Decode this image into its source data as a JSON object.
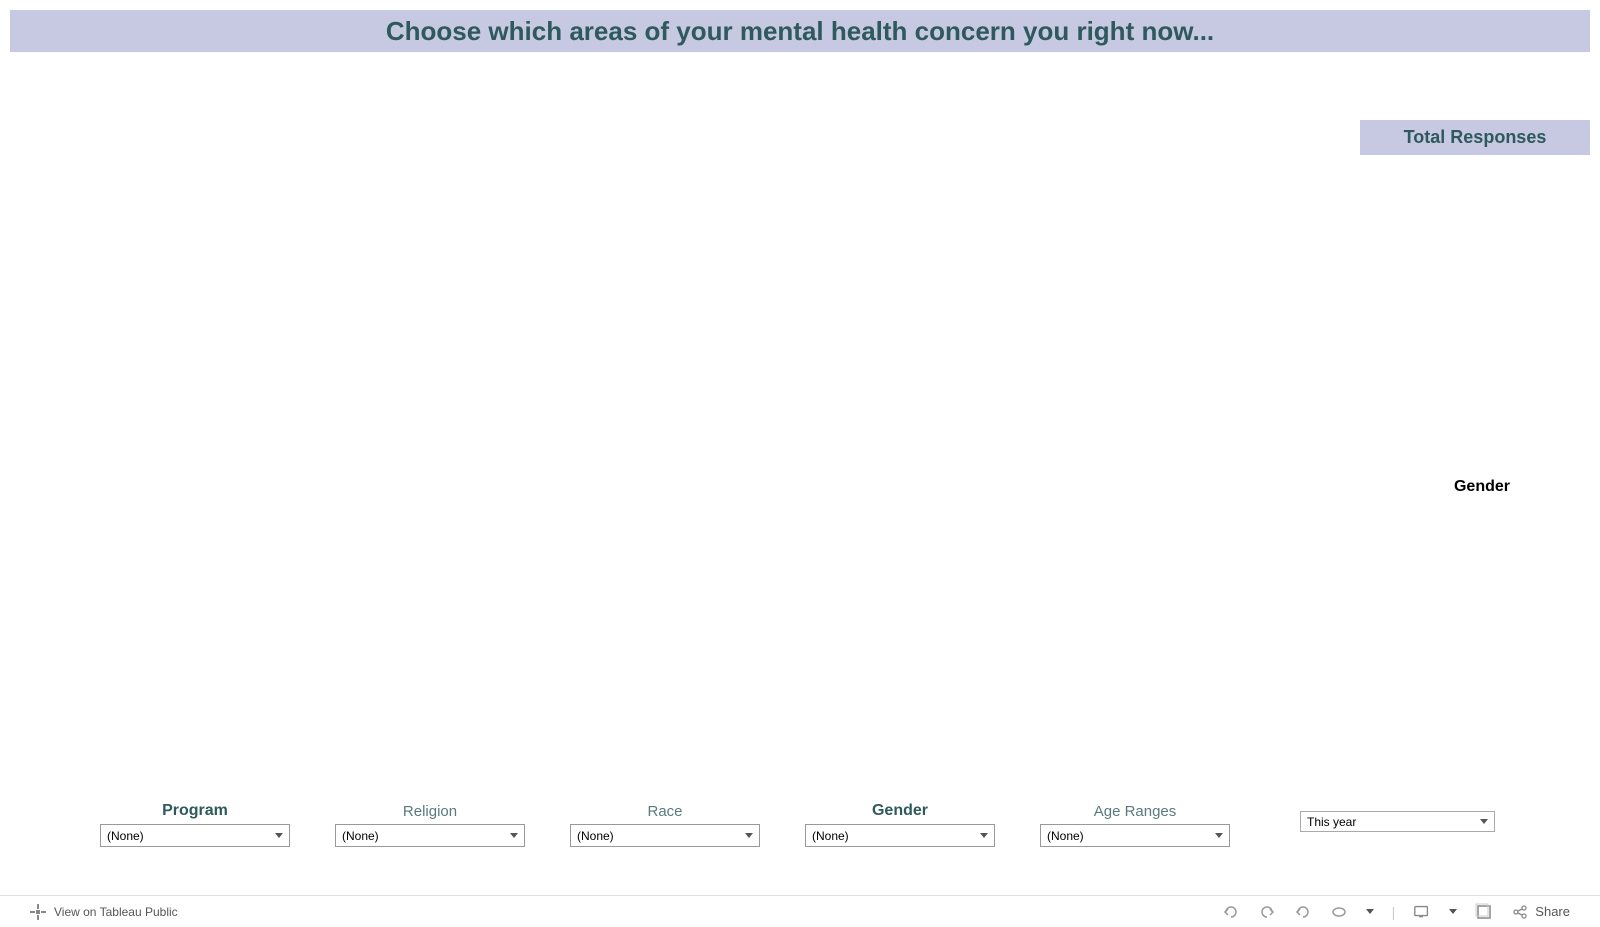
{
  "header": {
    "title": "Choose which areas of your mental health concern you right now..."
  },
  "side_panels": {
    "total_responses_label": "Total Responses",
    "gender_label": "Gender"
  },
  "filters": {
    "program": {
      "label": "Program",
      "value": "(None)"
    },
    "religion": {
      "label": "Religion",
      "value": "(None)"
    },
    "race": {
      "label": "Race",
      "value": "(None)"
    },
    "gender": {
      "label": "Gender",
      "value": "(None)"
    },
    "age_ranges": {
      "label": "Age Ranges",
      "value": "(None)"
    },
    "time": {
      "value": "This year"
    }
  },
  "toolbar": {
    "view_link": "View on Tableau Public",
    "share_label": "Share"
  }
}
